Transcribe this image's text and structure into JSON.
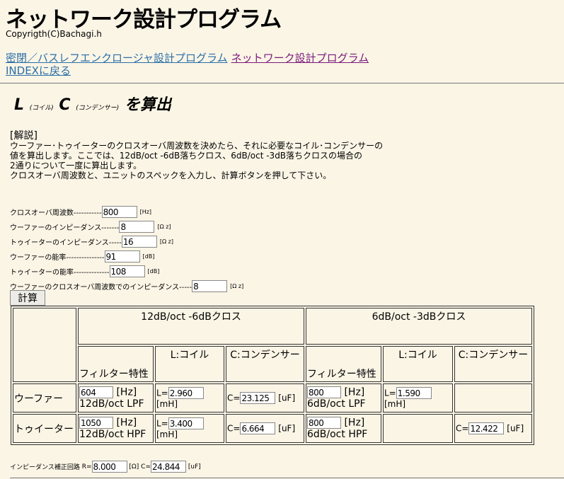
{
  "title": "ネットワーク設計プログラム",
  "copyright": "Copyrigth(C)Bachagi.h",
  "links": {
    "enclosure": "密閉／バスレフエンクロージャ設計プログラム",
    "network": "ネットワーク設計プログラム",
    "index": "INDEXに戻る"
  },
  "subtitle": {
    "l": "L",
    "l_note": "(コイル)",
    "c": "C",
    "c_note": "(コンデンサー)",
    "rest": "を算出"
  },
  "description": {
    "heading": "[解説]",
    "lines": [
      "ウーファー･トゥイーターのクロスオーバ周波数を決めたら、それに必要なコイル･コンデンサーの",
      "値を算出します。ここでは、12dB/oct -6dB落ちクロス、6dB/oct -3dB落ちクロスの場合の",
      "2通りについて一度に算出します。",
      "クロスオーバ周波数と、ユニットのスペックを入力し、計算ボタンを押して下さい。"
    ]
  },
  "form": [
    {
      "label": "クロスオーバ周波数-----------",
      "value": "800",
      "unit": "[Hz]"
    },
    {
      "label": "ウーファーのインピーダンス-------",
      "value": "8",
      "unit": "[Ω z]"
    },
    {
      "label": "トゥイーターのインピーダンス-----",
      "value": "16",
      "unit": "[Ω z]"
    },
    {
      "label": "ウーファーの能率---------------",
      "value": "91",
      "unit": "[dB]"
    },
    {
      "label": "トゥイーターの能率--------------",
      "value": "108",
      "unit": "[dB]"
    },
    {
      "label": "ウーファーのクロスオーバ周波数でのインピーダンス-----",
      "value": "8",
      "unit": "[Ω z]"
    }
  ],
  "calc_button": "計算",
  "table": {
    "group1": "12dB/oct -6dBクロス",
    "group2": "6dB/oct -3dBクロス",
    "col_filter": "フィルター特性",
    "col_l": "L:コイル",
    "col_c": "C:コンデンサー",
    "woofer": {
      "label": "ウーファー",
      "f1": "604",
      "f1_type": "12dB/oct LPF",
      "l1": "2.960",
      "c1": "23.125",
      "f2": "800",
      "f2_type": "6dB/oct LPF",
      "l2": "1.590"
    },
    "tweeter": {
      "label": "トゥイーター",
      "f1": "1050",
      "f1_type": "12dB/oct HPF",
      "l1": "3.400",
      "c1": "6.664",
      "f2": "800",
      "f2_type": "6dB/oct HPF",
      "c2": "12.422"
    },
    "hz": "[Hz]",
    "mh": "[mH]",
    "uf": "[uF]",
    "l_prefix": "L=",
    "c_prefix": "C="
  },
  "impedance_correction": {
    "label": "インピーダンス補正回路",
    "r_prefix": "R=",
    "r": "8.000",
    "r_unit": "[Ω]",
    "c_prefix": "C=",
    "c": "24.844",
    "c_unit": "[uF]"
  }
}
